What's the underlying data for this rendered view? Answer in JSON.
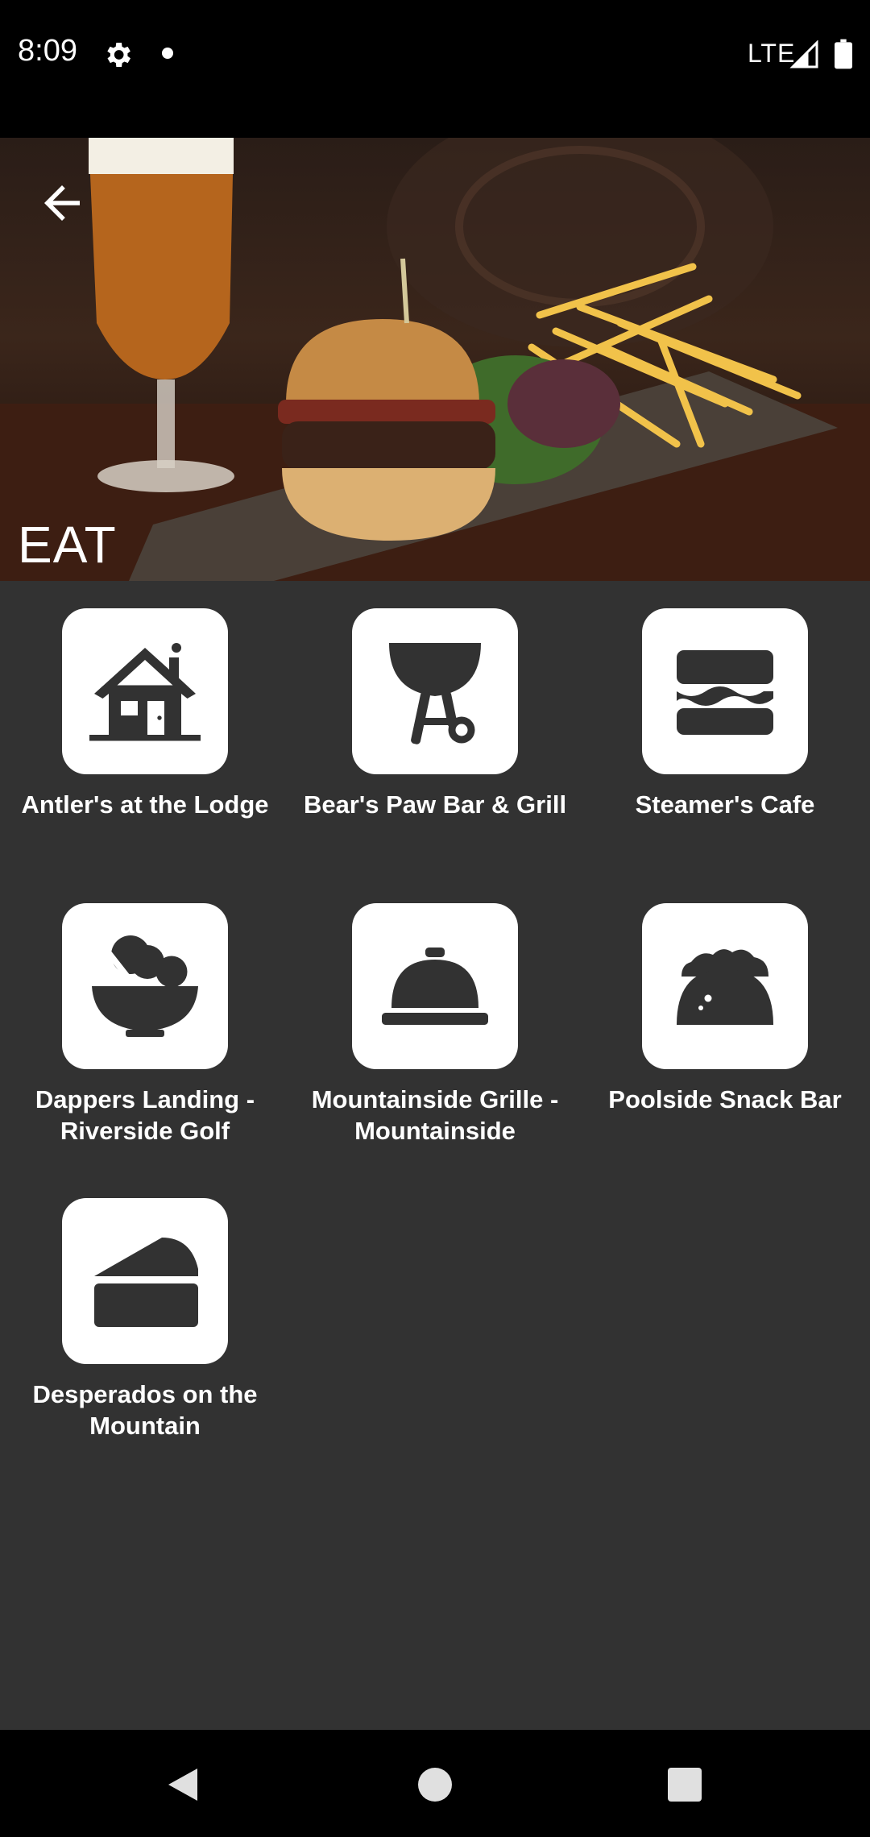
{
  "status_bar": {
    "time": "8:09",
    "network": "LTE",
    "icons": [
      "gear-icon",
      "notification-dot-icon",
      "signal-icon",
      "battery-icon"
    ]
  },
  "header": {
    "title": "EAT",
    "back_icon": "arrow-left-icon",
    "hero_image": "burger-fries-beer-photo"
  },
  "venues": [
    {
      "label": "Antler's at the Lodge",
      "icon": "lodge-house-icon"
    },
    {
      "label": "Bear's Paw Bar & Grill",
      "icon": "bbq-grill-icon"
    },
    {
      "label": "Steamer's Cafe",
      "icon": "burger-icon"
    },
    {
      "label": "Dappers Landing - Riverside Golf",
      "icon": "salad-bowl-icon"
    },
    {
      "label": "Mountainside Grille - Mountainside",
      "icon": "cloche-icon"
    },
    {
      "label": "Poolside Snack Bar",
      "icon": "taco-icon"
    },
    {
      "label": "Desperados on the Mountain",
      "icon": "pie-slice-icon"
    }
  ],
  "nav_bar": {
    "icons": [
      "nav-back-icon",
      "nav-home-icon",
      "nav-recent-icon"
    ]
  },
  "colors": {
    "background": "#323232",
    "tile": "#ffffff",
    "icon": "#323232",
    "bars": "#000000"
  }
}
